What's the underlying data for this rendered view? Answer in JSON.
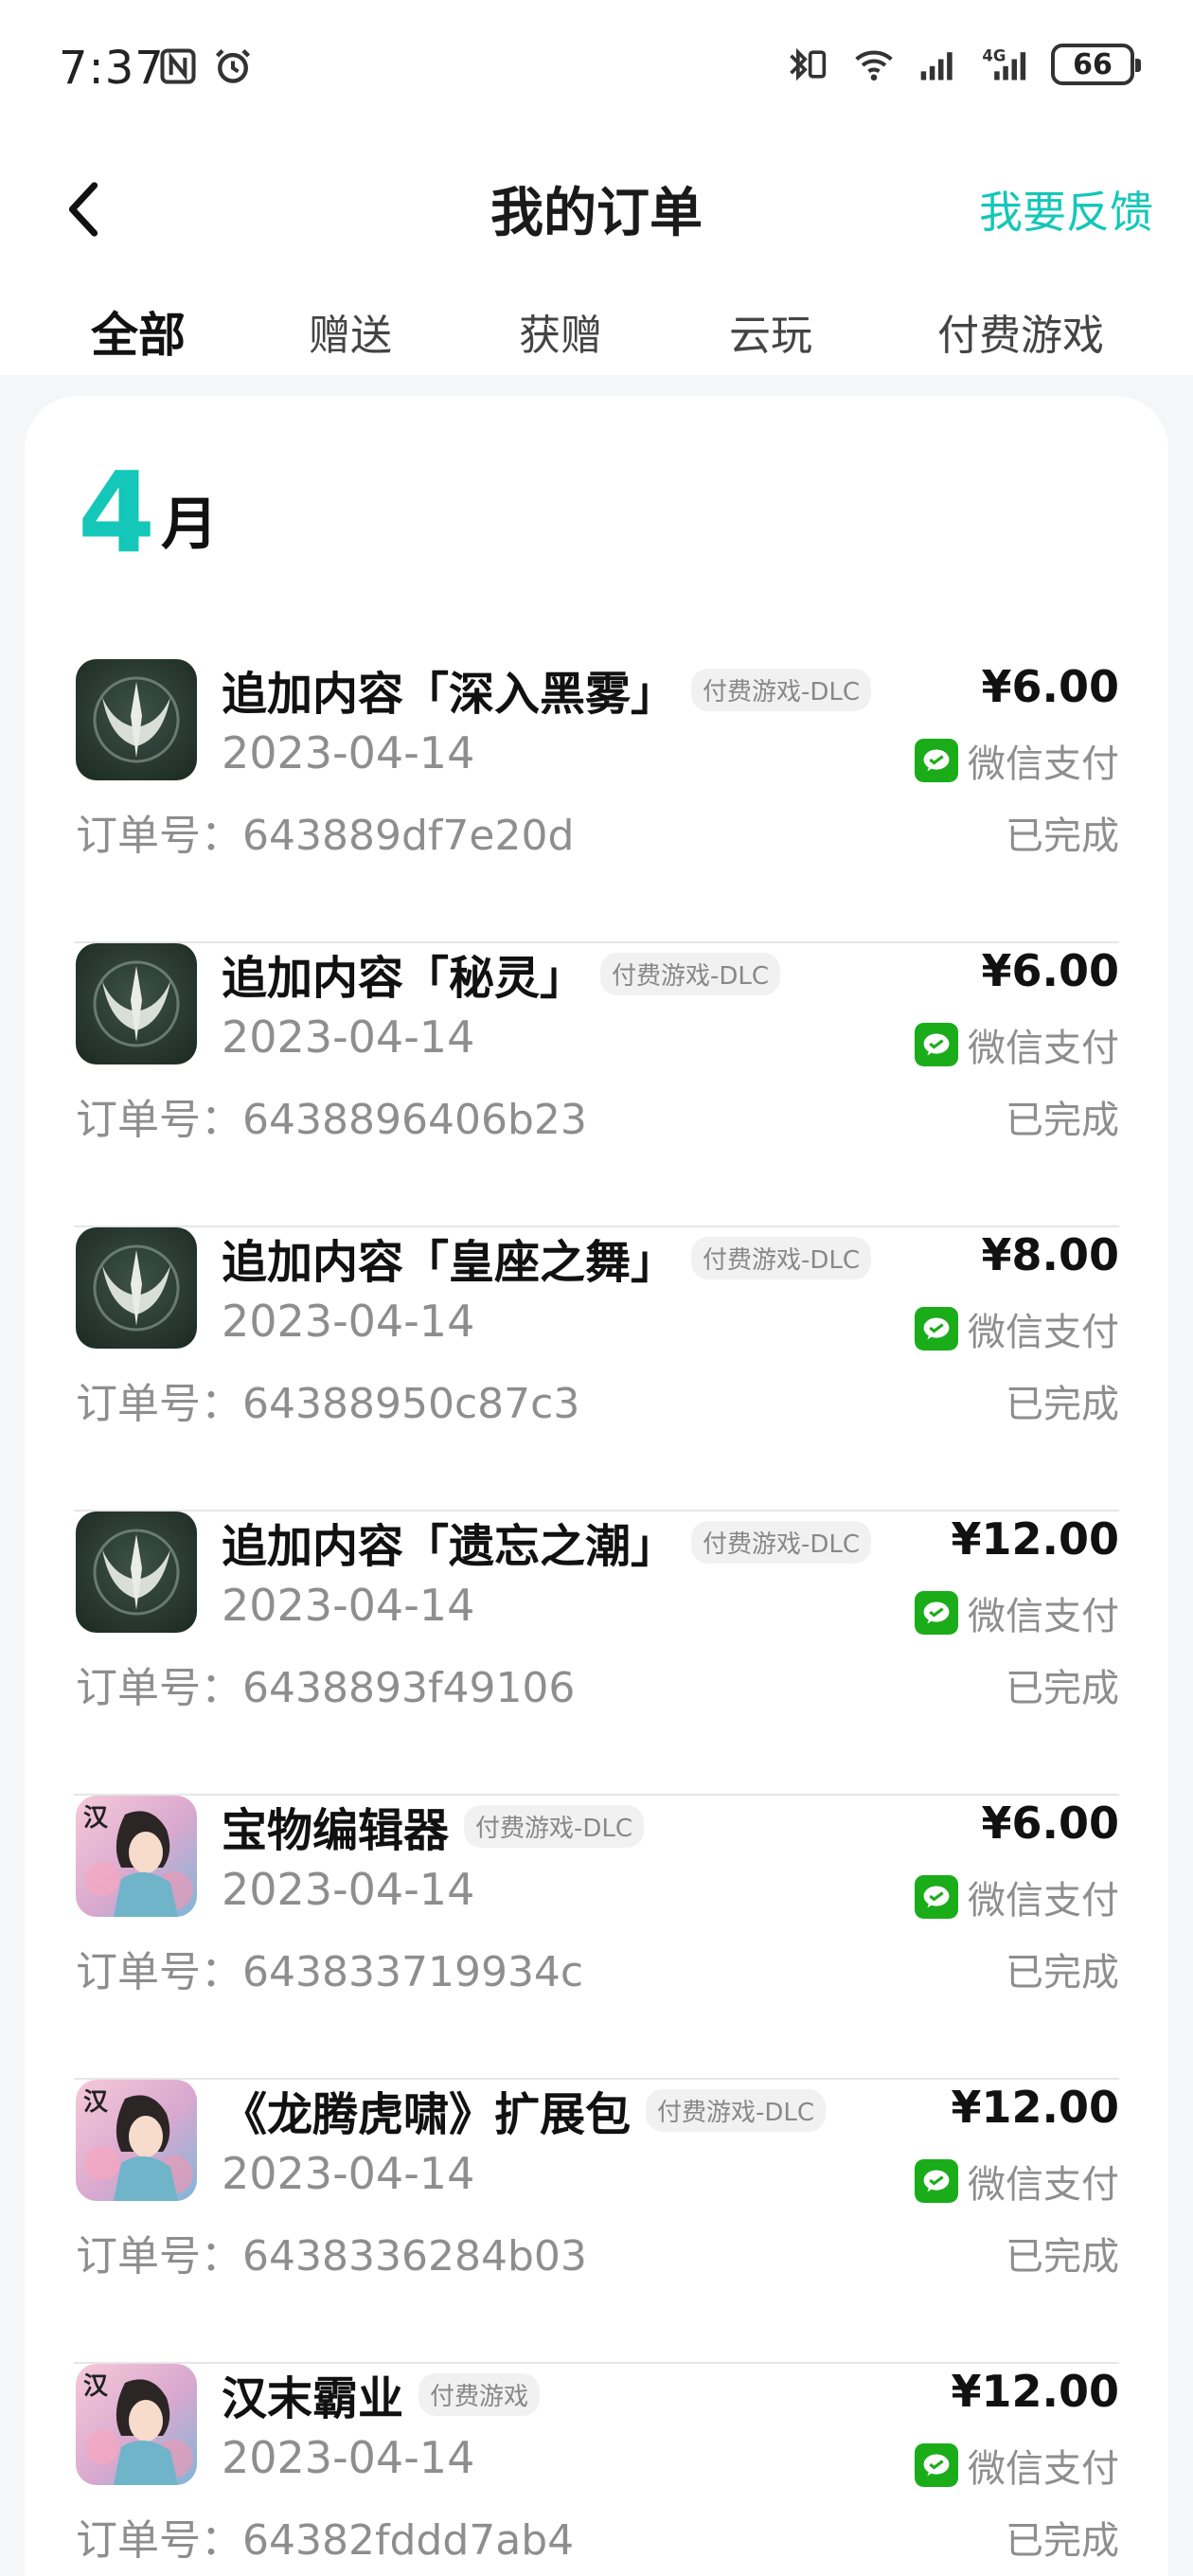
{
  "status_bar": {
    "time": "7:37",
    "battery": "66",
    "network_label": "4G"
  },
  "header": {
    "title": "我的订单",
    "feedback_label": "我要反馈",
    "back_icon": "chevron-left-icon"
  },
  "tabs": [
    {
      "label": "全部",
      "active": true
    },
    {
      "label": "赠送",
      "active": false
    },
    {
      "label": "获赠",
      "active": false
    },
    {
      "label": "云玩",
      "active": false
    },
    {
      "label": "付费游戏",
      "active": false
    }
  ],
  "month": {
    "number": "4",
    "unit": "月"
  },
  "colors": {
    "accent": "#14c7b8",
    "wechat_green": "#1aad19"
  },
  "order_no_prefix": "订单号：",
  "orders": [
    {
      "name": "追加内容「深入黑雾」",
      "tag": "付费游戏-DLC",
      "date": "2023-04-14",
      "price": "¥6.00",
      "payment": "微信支付",
      "order_no": "643889df7e20d",
      "status": "已完成",
      "icon": "dark-trident-game-icon"
    },
    {
      "name": " 追加内容「秘灵」",
      "tag": "付费游戏-DLC",
      "date": "2023-04-14",
      "price": "¥6.00",
      "payment": "微信支付",
      "order_no": "6438896406b23",
      "status": "已完成",
      "icon": "dark-trident-game-icon"
    },
    {
      "name": " 追加内容「皇座之舞」",
      "tag": "付费游戏-DLC",
      "date": "2023-04-14",
      "price": "¥8.00",
      "payment": "微信支付",
      "order_no": "64388950c87c3",
      "status": "已完成",
      "icon": "dark-trident-game-icon"
    },
    {
      "name": "追加内容「遗忘之潮」",
      "tag": "付费游戏-DLC",
      "date": "2023-04-14",
      "price": "¥12.00",
      "payment": "微信支付",
      "order_no": "6438893f49106",
      "status": "已完成",
      "icon": "dark-trident-game-icon"
    },
    {
      "name": "宝物编辑器",
      "tag": "付费游戏-DLC",
      "date": "2023-04-14",
      "price": "¥6.00",
      "payment": "微信支付",
      "order_no": "643833719934c",
      "status": "已完成",
      "icon": "han-heroine-game-icon"
    },
    {
      "name": "《龙腾虎啸》扩展包",
      "tag": "付费游戏-DLC",
      "date": "2023-04-14",
      "price": "¥12.00",
      "payment": "微信支付",
      "order_no": "6438336284b03",
      "status": "已完成",
      "icon": "han-heroine-game-icon"
    },
    {
      "name": "汉末霸业",
      "tag": "付费游戏",
      "date": "2023-04-14",
      "price": "¥12.00",
      "payment": "微信支付",
      "order_no": "64382fddd7ab4",
      "status": "已完成",
      "icon": "han-heroine-game-icon"
    }
  ]
}
